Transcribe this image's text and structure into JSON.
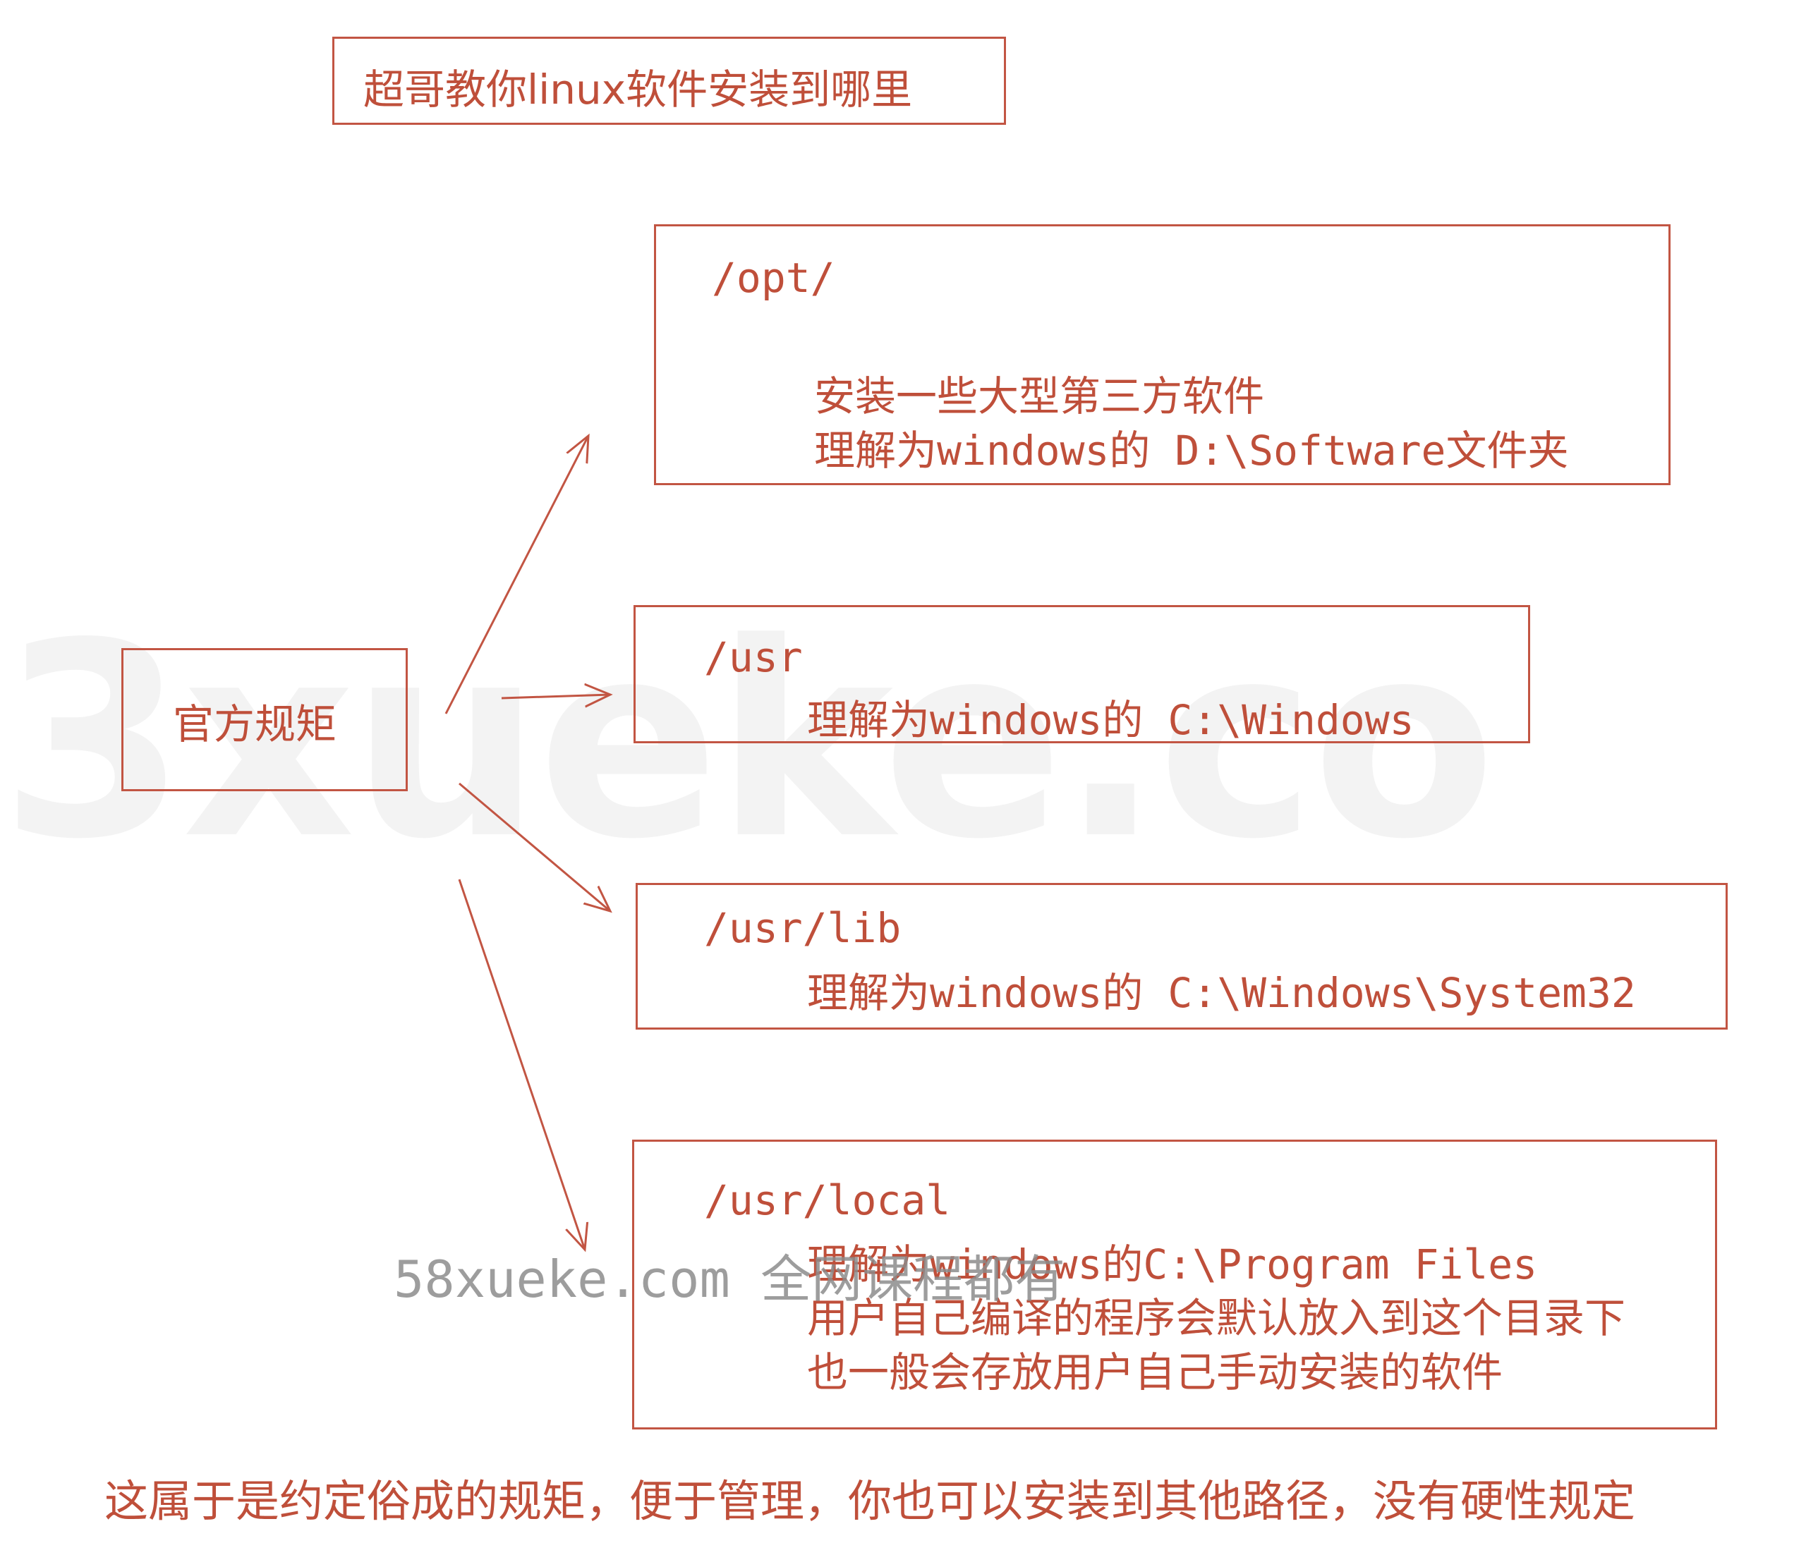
{
  "watermark_big": "3xueke.co",
  "watermark_small": "58xueke.com 全网课程都有",
  "title": "超哥教你linux软件安装到哪里",
  "root": "官方规矩",
  "boxes": [
    {
      "path": "/opt/",
      "lines": [
        "安装一些大型第三方软件",
        "理解为windows的  D:\\Software文件夹"
      ]
    },
    {
      "path": "/usr",
      "lines": [
        "理解为windows的 C:\\Windows"
      ]
    },
    {
      "path": "/usr/lib",
      "lines": [
        "理解为windows的 C:\\Windows\\System32"
      ]
    },
    {
      "path": "/usr/local",
      "lines": [
        "理解为windows的C:\\Program Files",
        "用户自己编译的程序会默认放入到这个目录下",
        "也一般会存放用户自己手动安装的软件"
      ]
    }
  ],
  "footer": "这属于是约定俗成的规矩，便于管理，你也可以安装到其他路径，没有硬性规定",
  "colors": {
    "accent": "#c25543"
  }
}
